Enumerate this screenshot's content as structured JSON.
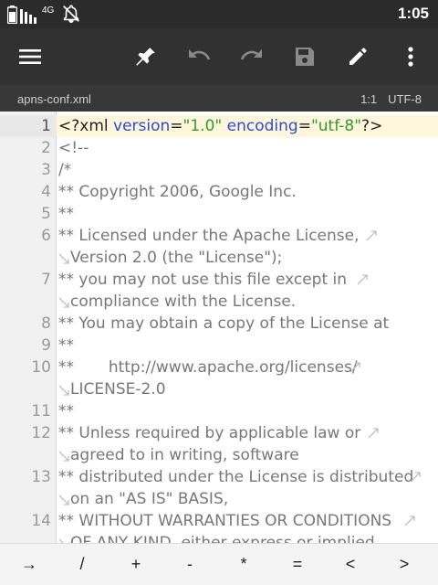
{
  "status": {
    "clock": "1:05",
    "network": "4G"
  },
  "toolbar": {
    "buttons": [
      "menu-icon",
      "pin-icon",
      "undo-icon",
      "redo-icon",
      "save-icon",
      "edit-icon",
      "more-vert-icon"
    ]
  },
  "info": {
    "filename": "apns-conf.xml",
    "position": "1:1",
    "encoding": "UTF-8"
  },
  "editor": {
    "line1": {
      "num": "1",
      "open": "<?",
      "tag": "xml",
      "attr1": "version",
      "eq1": "=",
      "val1": "\"1.0\"",
      "attr2": "encoding",
      "eq2": "=",
      "val2": "\"utf-8\"",
      "close": "?>"
    },
    "lines": [
      {
        "num": "2",
        "text": "<!--"
      },
      {
        "num": "3",
        "text": "/*"
      },
      {
        "num": "4",
        "text": "** Copyright 2006, Google Inc."
      },
      {
        "num": "5",
        "text": "**"
      },
      {
        "num": "6",
        "text": "** Licensed under the Apache License,",
        "cont": "Version 2.0 (the \"License\");"
      },
      {
        "num": "7",
        "text": "** you may not use this file except in",
        "cont": "compliance with the License."
      },
      {
        "num": "8",
        "text": "** You may obtain a copy of the License at"
      },
      {
        "num": "9",
        "text": "**"
      },
      {
        "num": "10",
        "text": "**       http://www.apache.org/licenses/",
        "cont": "LICENSE-2.0"
      },
      {
        "num": "11",
        "text": "**"
      },
      {
        "num": "12",
        "text": "** Unless required by applicable law or",
        "cont": "agreed to in writing, software"
      },
      {
        "num": "13",
        "text": "** distributed under the License is distributed",
        "cont": "on an \"AS IS\" BASIS,"
      },
      {
        "num": "14",
        "text": "** WITHOUT WARRANTIES OR CONDITIONS",
        "cont": "OF ANY KIND, either express or implied."
      }
    ]
  },
  "keys": [
    "→",
    "/",
    "+",
    "-",
    "*",
    "=",
    "<",
    ">"
  ]
}
